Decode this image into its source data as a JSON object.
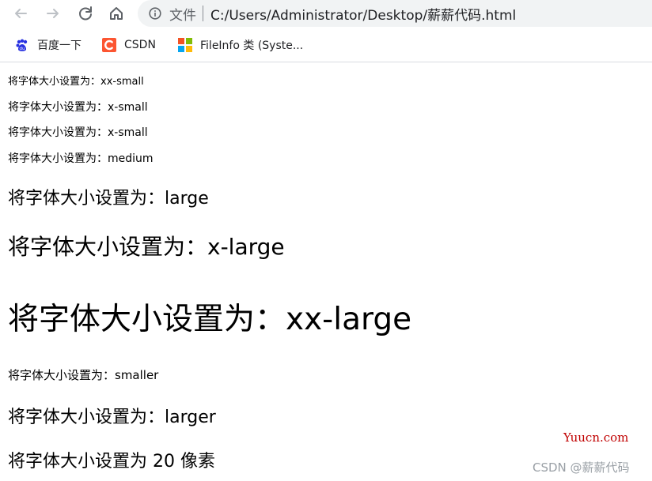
{
  "browser": {
    "toolbar": {
      "back_icon": "arrow-left-icon",
      "forward_icon": "arrow-right-icon",
      "reload_icon": "reload-icon",
      "home_icon": "home-icon",
      "address": {
        "info_icon": "info-icon",
        "scheme_label": "文件",
        "url": "C:/Users/Administrator/Desktop/薪薪代码.html"
      }
    },
    "bookmarks": [
      {
        "label": "百度一下",
        "icon": "baidu-icon"
      },
      {
        "label": "CSDN",
        "icon": "csdn-icon"
      },
      {
        "label": "FileInfo 类 (Syste...",
        "icon": "windows-icon"
      }
    ]
  },
  "page": {
    "lines": [
      "将字体大小设置为：xx-small",
      "将字体大小设置为：x-small",
      "将字体大小设置为：x-small",
      "将字体大小设置为：medium",
      "将字体大小设置为：large",
      "将字体大小设置为：x-large",
      "将字体大小设置为：xx-large",
      "将字体大小设置为：smaller",
      "将字体大小设置为：larger",
      "将字体大小设置为 20 像素"
    ]
  },
  "watermarks": {
    "yuucn": "Yuucn.com",
    "csdn": "CSDN @薪薪代码"
  },
  "colors": {
    "watermark_red": "#c00000",
    "omnibox_bg": "#f1f3f4",
    "icon_gray": "#5f6368"
  }
}
